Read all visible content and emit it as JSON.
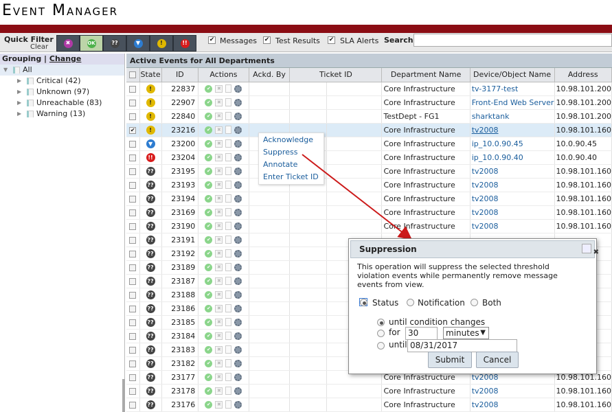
{
  "app": {
    "title": "Event Manager"
  },
  "quick_filter": {
    "label": "Quick Filter",
    "clear": "Clear",
    "buttons": [
      {
        "icon": "x-icon",
        "glyph": "✖",
        "cls": "d-x"
      },
      {
        "icon": "ok-icon",
        "glyph": "OK",
        "cls": "d-ok"
      },
      {
        "icon": "unknown-icon",
        "glyph": "??",
        "cls": "d-unk"
      },
      {
        "icon": "down-icon",
        "glyph": "▼",
        "cls": "d-down"
      },
      {
        "icon": "warning-icon",
        "glyph": "!",
        "cls": "d-warn"
      },
      {
        "icon": "critical-icon",
        "glyph": "!!",
        "cls": "d-crit"
      }
    ]
  },
  "checks": {
    "messages": "Messages",
    "test_results": "Test Results",
    "sla_alerts": "SLA Alerts"
  },
  "search": {
    "label": "Search",
    "value": ""
  },
  "grouping": {
    "label": "Grouping",
    "sep": " | ",
    "change": "Change"
  },
  "tree": [
    {
      "label": "All",
      "selected": true
    },
    {
      "label": "Critical (42)"
    },
    {
      "label": "Unknown (97)"
    },
    {
      "label": "Unreachable (83)"
    },
    {
      "label": "Warning (13)"
    }
  ],
  "events": {
    "title": "Active Events for All Departments",
    "columns": [
      "State",
      "ID",
      "Actions",
      "Ackd. By",
      "Ticket ID",
      "Department Name",
      "Device/Object Name",
      "Address"
    ],
    "rows": [
      {
        "state": "warn",
        "id": "22837",
        "dept": "Core Infrastructure",
        "device": "tv-3177-test",
        "address": "10.98.101.200",
        "checked": false
      },
      {
        "state": "warn",
        "id": "22907",
        "dept": "Core Infrastructure",
        "device": "Front-End Web Server",
        "address": "10.98.101.200",
        "checked": false
      },
      {
        "state": "warn",
        "id": "22840",
        "dept": "TestDept - FG1",
        "device": "sharktank",
        "address": "10.98.101.200",
        "checked": false
      },
      {
        "state": "warn",
        "id": "23216",
        "dept": "Core Infrastructure",
        "device": "tv2008",
        "address": "10.98.101.160",
        "checked": true
      },
      {
        "state": "down",
        "id": "23200",
        "dept": "Core Infrastructure",
        "device": "ip_10.0.90.45",
        "address": "10.0.90.45",
        "checked": false
      },
      {
        "state": "crit",
        "id": "23204",
        "dept": "Core Infrastructure",
        "device": "ip_10.0.90.40",
        "address": "10.0.90.40",
        "checked": false
      },
      {
        "state": "unk",
        "id": "23195",
        "dept": "Core Infrastructure",
        "device": "tv2008",
        "address": "10.98.101.160",
        "checked": false
      },
      {
        "state": "unk",
        "id": "23193",
        "dept": "Core Infrastructure",
        "device": "tv2008",
        "address": "10.98.101.160",
        "checked": false
      },
      {
        "state": "unk",
        "id": "23194",
        "dept": "Core Infrastructure",
        "device": "tv2008",
        "address": "10.98.101.160",
        "checked": false
      },
      {
        "state": "unk",
        "id": "23169",
        "dept": "Core Infrastructure",
        "device": "tv2008",
        "address": "10.98.101.160",
        "checked": false
      },
      {
        "state": "unk",
        "id": "23190",
        "dept": "Core Infrastructure",
        "device": "tv2008",
        "address": "10.98.101.160",
        "checked": false
      },
      {
        "state": "unk",
        "id": "23191",
        "dept": "",
        "device": "",
        "address": "",
        "checked": false
      },
      {
        "state": "unk",
        "id": "23192",
        "dept": "",
        "device": "",
        "address": "",
        "checked": false
      },
      {
        "state": "unk",
        "id": "23189",
        "dept": "",
        "device": "",
        "address": "",
        "checked": false
      },
      {
        "state": "unk",
        "id": "23187",
        "dept": "",
        "device": "",
        "address": "",
        "checked": false
      },
      {
        "state": "unk",
        "id": "23188",
        "dept": "",
        "device": "",
        "address": "",
        "checked": false
      },
      {
        "state": "unk",
        "id": "23186",
        "dept": "",
        "device": "",
        "address": "",
        "checked": false
      },
      {
        "state": "unk",
        "id": "23185",
        "dept": "",
        "device": "",
        "address": "",
        "checked": false
      },
      {
        "state": "unk",
        "id": "23184",
        "dept": "",
        "device": "",
        "address": "",
        "checked": false
      },
      {
        "state": "unk",
        "id": "23183",
        "dept": "",
        "device": "",
        "address": "",
        "checked": false
      },
      {
        "state": "unk",
        "id": "23182",
        "dept": "",
        "device": "",
        "address": "",
        "checked": false
      },
      {
        "state": "unk",
        "id": "23177",
        "dept": "Core Infrastructure",
        "device": "tv2008",
        "address": "10.98.101.160",
        "checked": false
      },
      {
        "state": "unk",
        "id": "23178",
        "dept": "Core Infrastructure",
        "device": "tv2008",
        "address": "10.98.101.160",
        "checked": false
      },
      {
        "state": "unk",
        "id": "23176",
        "dept": "Core Infrastructure",
        "device": "tv2008",
        "address": "10.98.101.160",
        "checked": false
      }
    ]
  },
  "context_menu": [
    "Acknowledge",
    "Suppress",
    "Annotate",
    "Enter Ticket ID"
  ],
  "dialog": {
    "title": "Suppression",
    "message": "This operation will suppress the selected threshold violation events while permanently remove message events from view.",
    "types": [
      "Status",
      "Notification",
      "Both"
    ],
    "until_condition": "until condition changes",
    "for_label": "for",
    "for_value": "30",
    "for_unit": "minutes",
    "until_label": "until",
    "until_value": "08/31/2017",
    "submit": "Submit",
    "cancel": "Cancel"
  },
  "colors": {
    "brand_bar": "#8b0d14",
    "link": "#1a5d9c",
    "arrow": "#cc1a1a"
  }
}
